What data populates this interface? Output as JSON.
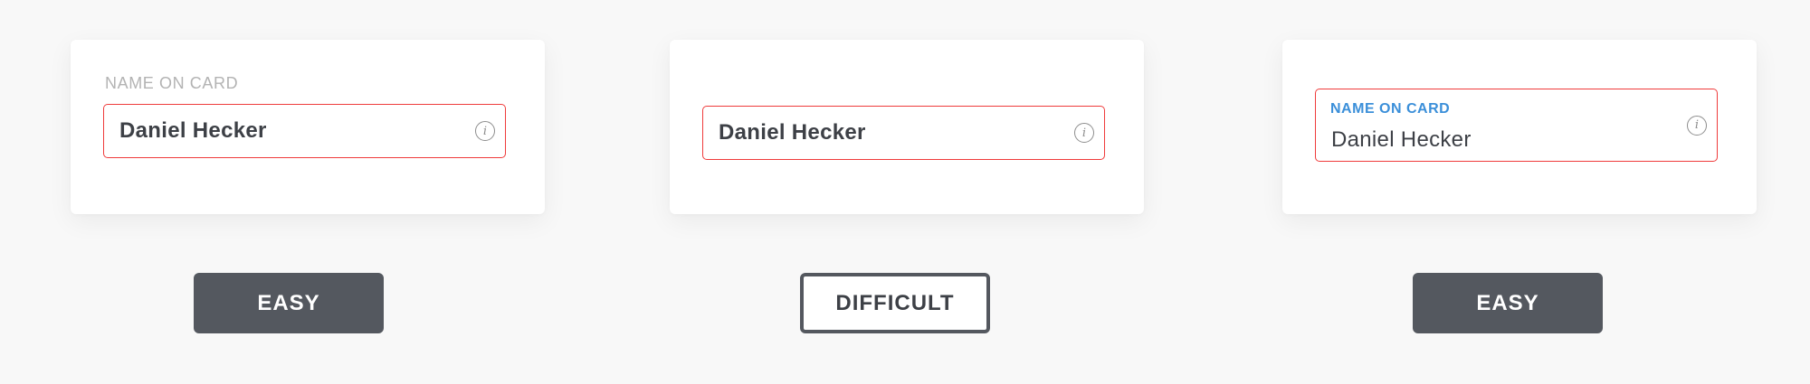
{
  "examples": [
    {
      "label": "NAME ON CARD",
      "value": "Daniel Hecker",
      "info_icon": "info-icon",
      "rating": "EASY"
    },
    {
      "label": "",
      "value": "Daniel Hecker",
      "info_icon": "info-icon",
      "rating": "DIFFICULT"
    },
    {
      "label": "NAME ON CARD",
      "value": "Daniel Hecker",
      "info_icon": "info-icon",
      "rating": "EASY"
    }
  ],
  "colors": {
    "background": "#f8f8f8",
    "card": "#ffffff",
    "error_border": "#ef3b3b",
    "focus_label": "#3b8fd9",
    "muted_label": "#b3b3b3",
    "tag_dark": "#54585f",
    "text": "#3d4046"
  }
}
